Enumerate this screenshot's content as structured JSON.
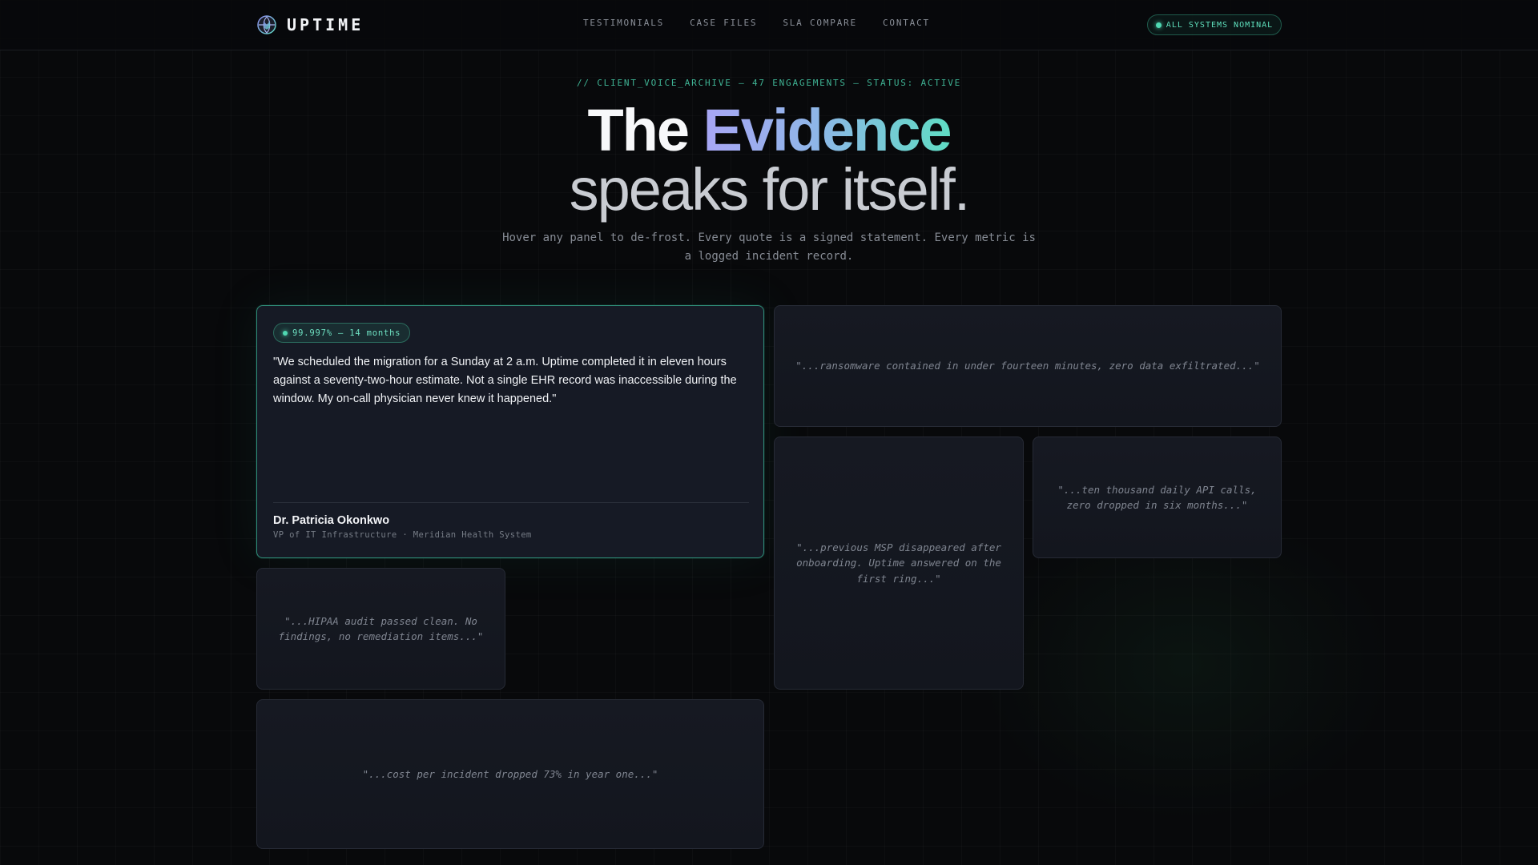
{
  "brand": {
    "name": "UPTIME",
    "logo_icon": "globe-shield-icon"
  },
  "nav": {
    "items": [
      {
        "label": "TESTIMONIALS"
      },
      {
        "label": "CASE FILES"
      },
      {
        "label": "SLA COMPARE"
      },
      {
        "label": "CONTACT"
      }
    ]
  },
  "status": {
    "label": "ALL SYSTEMS NOMINAL",
    "color": "#4fd8b2"
  },
  "hero": {
    "eyebrow": "// CLIENT_VOICE_ARCHIVE — 47 ENGAGEMENTS — STATUS: ACTIVE",
    "title_plain": "The",
    "title_accent": "Evidence",
    "title_line2": "speaks for itself.",
    "subtitle": "Hover any panel to de-frost. Every quote is a signed statement. Every metric is a logged incident record."
  },
  "featured": {
    "metric": "99.997% — 14 months",
    "quote": "\"We scheduled the migration for a Sunday at 2 a.m. Uptime completed it in eleven hours against a seventy-two-hour estimate. Not a single EHR record was inaccessible during the window. My on-call physician never knew it happened.\"",
    "author": "Dr. Patricia Okonkwo",
    "role": "VP of IT Infrastructure · Meridian Health System",
    "accent_color": "#2f8c78"
  },
  "frosted": [
    {
      "excerpt": "\"...ransomware contained in under fourteen minutes, zero data exfiltrated...\""
    },
    {
      "excerpt": "\"...previous MSP disappeared after onboarding. Uptime answered on the first ring...\""
    },
    {
      "excerpt": "\"...ten thousand daily API calls, zero dropped in six months...\""
    },
    {
      "excerpt": "\"...HIPAA audit passed clean. No findings, no remediation items...\""
    },
    {
      "excerpt": "\"...cost per incident dropped 73% in year one...\""
    }
  ]
}
